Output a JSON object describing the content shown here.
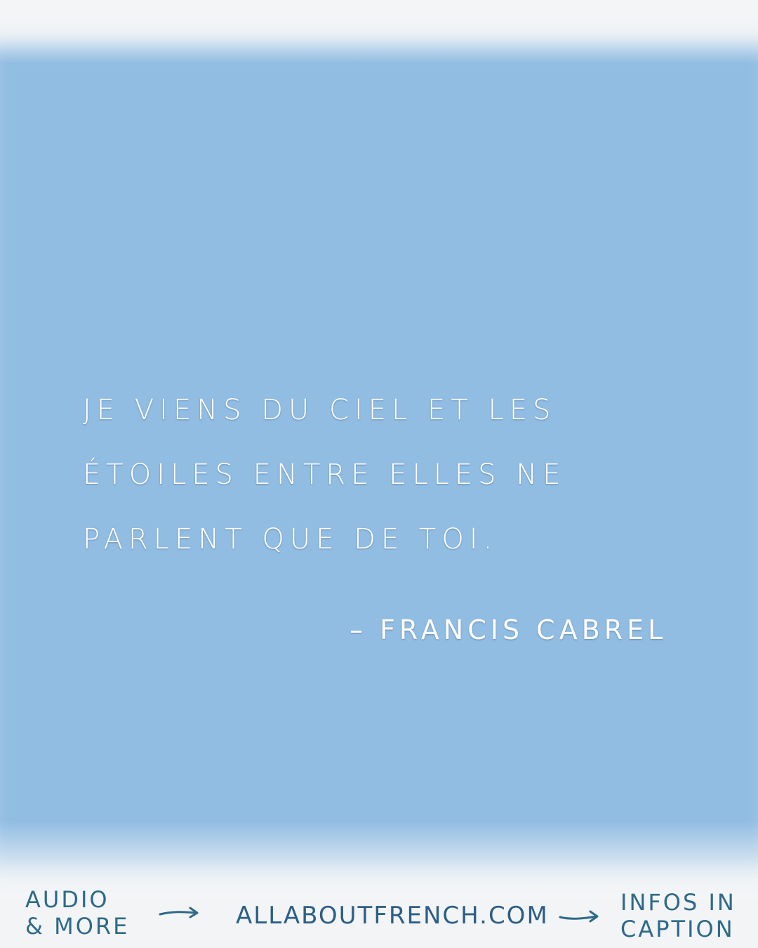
{
  "quote": {
    "lines": [
      "JE VIENS DU CIEL ET LES",
      "ÉTOILES ENTRE ELLES NE",
      "PARLENT QUE DE TOI."
    ],
    "author": "– FRANCIS CABREL"
  },
  "footer": {
    "left_lines": [
      "AUDIO",
      "& MORE"
    ],
    "site": "ALLABOUTFRENCH.COM",
    "right_lines": [
      "INFOS IN",
      "CAPTION"
    ]
  },
  "colors": {
    "sky": "#92bde3",
    "paper": "#f2f4f6",
    "quote_text": "#ffffff",
    "footer_text": "#2e6a88"
  },
  "icons": [
    "arrow-right-icon",
    "arrow-right-icon"
  ]
}
